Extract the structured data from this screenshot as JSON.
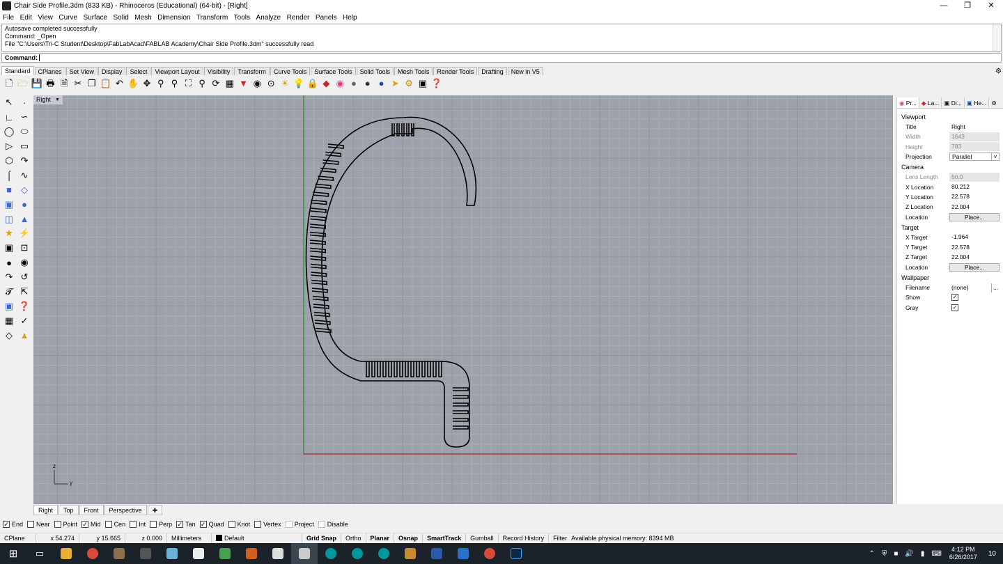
{
  "window": {
    "title": "Chair Side Profile.3dm (833 KB) - Rhinoceros (Educational) (64-bit) - [Right]"
  },
  "menu": [
    "File",
    "Edit",
    "View",
    "Curve",
    "Surface",
    "Solid",
    "Mesh",
    "Dimension",
    "Transform",
    "Tools",
    "Analyze",
    "Render",
    "Panels",
    "Help"
  ],
  "command_history": [
    "Autosave completed successfully",
    "Command: _Open",
    "File \"C:\\Users\\Tri-C Student\\Desktop\\FabLabAcad\\FABLAB Academy\\Chair Side Profile.3dm\" successfully read"
  ],
  "command_prompt": "Command:",
  "toolbar_tabs": [
    "Standard",
    "CPlanes",
    "Set View",
    "Display",
    "Select",
    "Viewport Layout",
    "Visibility",
    "Transform",
    "Curve Tools",
    "Surface Tools",
    "Solid Tools",
    "Mesh Tools",
    "Render Tools",
    "Drafting",
    "New in V5"
  ],
  "toolbar_icons": [
    "new-file-icon",
    "open-folder-icon",
    "save-icon",
    "print-icon",
    "import-icon",
    "cut-icon",
    "copy-icon",
    "paste-icon",
    "undo-icon",
    "pan-icon",
    "move-view-icon",
    "zoom-icon",
    "zoom-window-icon",
    "zoom-extents-icon",
    "zoom-selected-icon",
    "rotate-view-icon",
    "four-viewports-icon",
    "car-icon",
    "camera-icon",
    "grid-options-icon",
    "shaded-icon",
    "lightbulb-icon",
    "lock-icon",
    "layer-color-icon",
    "color-wheel-icon",
    "render-sphere-icon",
    "rendered-sphere-icon",
    "blue-sphere-icon",
    "pointer-icon",
    "settings-icon",
    "options-icon",
    "help-icon"
  ],
  "left_toolbar_icons": [
    "select-icon",
    "point-icon",
    "polyline-icon",
    "curve-points-icon",
    "circle-icon",
    "ellipse-icon",
    "arc-icon",
    "rectangle-icon",
    "polygon-icon",
    "freeform-curve-icon",
    "curve-fillet-icon",
    "offset-curve-icon",
    "surface-icon",
    "extrude-surface-icon",
    "box-icon",
    "sphere-icon",
    "cylinder-icon",
    "extrude-solid-icon",
    "boolean-union-icon",
    "boolean-difference-icon",
    "mesh-icon",
    "explode-icon",
    "fillet-icon",
    "chamfer-icon",
    "text-icon",
    "dimension-icon",
    "block-icon",
    "grid-icon",
    "array-icon",
    "transform-icon",
    "analyze-icon",
    "check-icon",
    "render-icon",
    "light-icon"
  ],
  "viewport": {
    "name": "Right",
    "axis_z": "z",
    "axis_y": "y"
  },
  "viewport_tabs": [
    "Right",
    "Top",
    "Front",
    "Perspective"
  ],
  "osnaps": [
    {
      "label": "End",
      "checked": true
    },
    {
      "label": "Near",
      "checked": false
    },
    {
      "label": "Point",
      "checked": false
    },
    {
      "label": "Mid",
      "checked": true
    },
    {
      "label": "Cen",
      "checked": false
    },
    {
      "label": "Int",
      "checked": false
    },
    {
      "label": "Perp",
      "checked": false
    },
    {
      "label": "Tan",
      "checked": true
    },
    {
      "label": "Quad",
      "checked": true
    },
    {
      "label": "Knot",
      "checked": false
    },
    {
      "label": "Vertex",
      "checked": false
    },
    {
      "label": "Project",
      "checked": false,
      "disabled": true
    },
    {
      "label": "Disable",
      "checked": false,
      "disabled": true
    }
  ],
  "status": {
    "cplane": "CPlane",
    "x": "x 54.274",
    "y": "y 15.665",
    "z": "z 0.000",
    "units": "Millimeters",
    "layer": "Default",
    "grid_snap": "Grid Snap",
    "ortho": "Ortho",
    "planar": "Planar",
    "osnap": "Osnap",
    "smarttrack": "SmartTrack",
    "gumball": "Gumball",
    "record_history": "Record History",
    "filter": "Filter",
    "memory": "Available physical memory: 8394 MB"
  },
  "panel": {
    "tabs": [
      "Pr...",
      "La...",
      "Di...",
      "He..."
    ],
    "viewport_section": "Viewport",
    "title_label": "Title",
    "title_value": "Right",
    "width_label": "Width",
    "width_value": "1643",
    "height_label": "Height",
    "height_value": "783",
    "projection_label": "Projection",
    "projection_value": "Parallel",
    "camera_section": "Camera",
    "lens_label": "Lens Length",
    "lens_value": "50.0",
    "xloc_label": "X Location",
    "xloc_value": "80.212",
    "yloc_label": "Y Location",
    "yloc_value": "22.578",
    "zloc_label": "Z Location",
    "zloc_value": "22.004",
    "location_label": "Location",
    "place_label": "Place...",
    "target_section": "Target",
    "xt_label": "X Target",
    "xt_value": "-1.964",
    "yt_label": "Y Target",
    "yt_value": "22.578",
    "zt_label": "Z Target",
    "zt_value": "22.004",
    "tloc_label": "Location",
    "tplace_label": "Place...",
    "wallpaper_section": "Wallpaper",
    "filename_label": "Filename",
    "filename_value": "(none)",
    "show_label": "Show",
    "show_checked": true,
    "gray_label": "Gray",
    "gray_checked": true
  },
  "taskbar": {
    "time": "4:12 PM",
    "date": "6/26/2017",
    "notifications": "10"
  },
  "colors": {
    "viewport_bg": "#9da2aa",
    "y_axis": "#2e8b2e",
    "x_axis": "#b22222",
    "curve": "#000000"
  }
}
